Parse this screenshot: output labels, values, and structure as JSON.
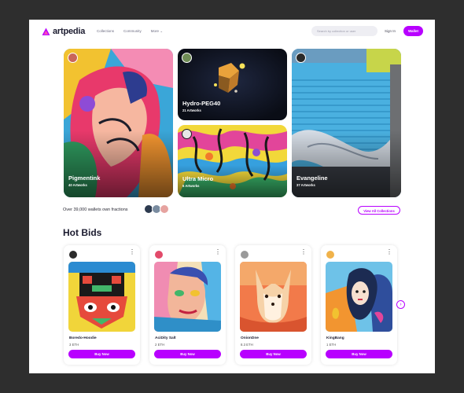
{
  "brand": {
    "name": "artpedia",
    "accent": "#b800ff"
  },
  "nav": {
    "items": [
      "Collections",
      "Community",
      "More"
    ]
  },
  "search": {
    "placeholder": "Search by collection or user"
  },
  "auth": {
    "signin": "Sign In",
    "wallet": "Wallet"
  },
  "collections": [
    {
      "title": "Pigmentink",
      "subtitle": "40 Artworks"
    },
    {
      "title": "Hydro-PEG40",
      "subtitle": "21 Artworks"
    },
    {
      "title": "Ultra Micro",
      "subtitle": "6 Artworks"
    },
    {
      "title": "Evangeline",
      "subtitle": "37 Artworks"
    }
  ],
  "owners_text": "Over 39,000 wallets own fractions",
  "view_all": "View All Collections",
  "hot_bids": {
    "title": "Hot Bids",
    "buy_label": "Buy Now",
    "items": [
      {
        "name": "Boredo-Hoodie",
        "price": "3 ETH"
      },
      {
        "name": "AciDity Salt",
        "price": "2 ETH"
      },
      {
        "name": "OnionDne",
        "price": "8.3 ETH"
      },
      {
        "name": "KingBang",
        "price": "1 ETH"
      }
    ]
  },
  "icons": {
    "more": "more-vertical-icon",
    "next": "chevron-right-icon",
    "nav_more": "chevron-down-icon"
  }
}
